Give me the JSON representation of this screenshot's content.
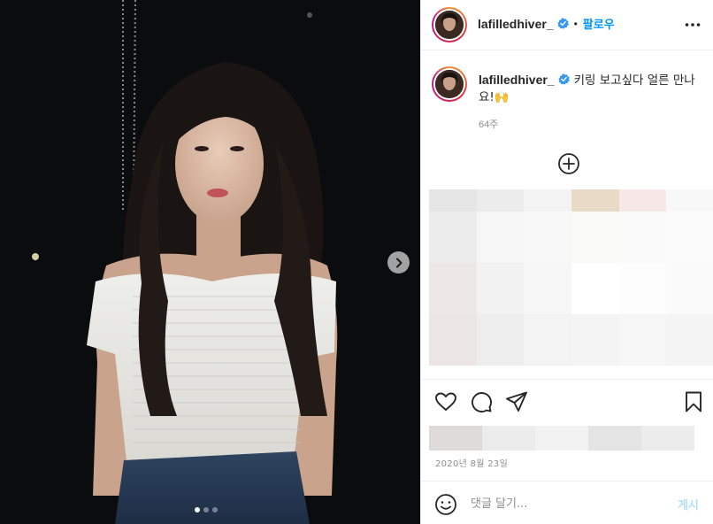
{
  "post": {
    "username": "lafilledhiver_",
    "verified": true,
    "follow_label": "팔로우",
    "separator": "•",
    "more_icon": "more-horizontal-icon"
  },
  "caption": {
    "username": "lafilledhiver_",
    "text": "키링 보고싶다 얼른 만나요!🙌",
    "age": "64주"
  },
  "carousel": {
    "slide_count": 3,
    "active_index": 0,
    "next_icon": "chevron-right-icon"
  },
  "actions": {
    "like_icon": "heart-icon",
    "comment_icon": "comment-icon",
    "share_icon": "paper-plane-icon",
    "save_icon": "bookmark-icon"
  },
  "date": "2020년 8월 23일",
  "comment": {
    "placeholder": "댓글 달기...",
    "post_label": "게시",
    "emoji_icon": "smile-emoji-icon"
  },
  "colors": {
    "accent": "#0095f6",
    "post_disabled": "#b2dffc",
    "verified": "#3897f0"
  }
}
